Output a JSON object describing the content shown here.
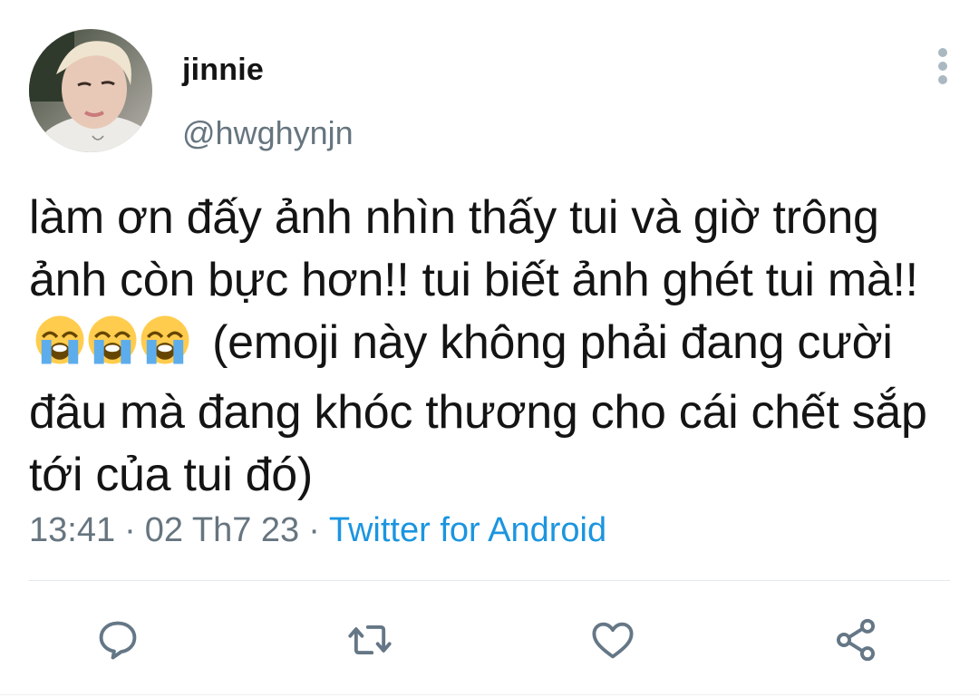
{
  "tweet": {
    "display_name": "jinnie",
    "handle": "@hwghynjn",
    "text_part1": "làm ơn đấy ảnh nhìn thấy tui và giờ trông ảnh còn bực hơn!! tui biết ảnh ghét tui mà!!",
    "emoji": "😭",
    "text_part2": "(emoji này không phải đang cười đâu mà đang khóc thương cho cái chết sắp tới của tui đó)",
    "time": "13:41",
    "date": "02 Th7 23",
    "separator": "·",
    "source": "Twitter for Android"
  },
  "actions": [
    {
      "name": "reply",
      "icon": "reply-icon"
    },
    {
      "name": "retweet",
      "icon": "retweet-icon"
    },
    {
      "name": "like",
      "icon": "heart-icon"
    },
    {
      "name": "share",
      "icon": "share-icon"
    }
  ],
  "colors": {
    "secondary_text": "#66757f",
    "link": "#1b95e0",
    "icon": "#657786",
    "divider": "#e1e8ed"
  }
}
